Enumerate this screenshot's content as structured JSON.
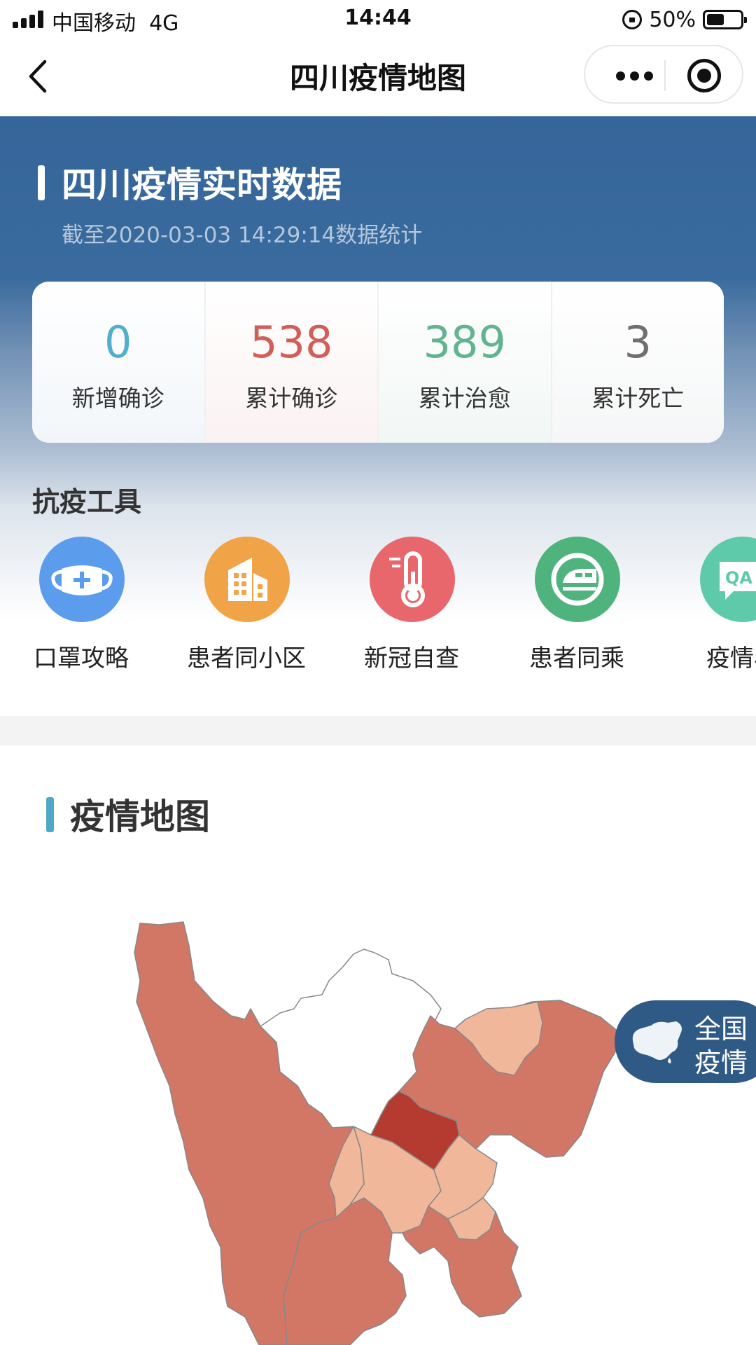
{
  "status_bar": {
    "carrier": "中国移动",
    "network": "4G",
    "time": "14:44",
    "battery_percent": "50%",
    "battery_level": 0.5
  },
  "nav": {
    "title": "四川疫情地图",
    "back_icon": "chevron-left-icon",
    "more_icon": "more-dots-icon",
    "close_icon": "target-close-icon"
  },
  "hero": {
    "title": "四川疫情实时数据",
    "subtitle": "截至2020-03-03 14:29:14数据统计"
  },
  "stats": [
    {
      "value": "0",
      "label": "新增确诊",
      "color": "#52aecb"
    },
    {
      "value": "538",
      "label": "累计确诊",
      "color": "#cf5f58"
    },
    {
      "value": "389",
      "label": "累计治愈",
      "color": "#62b491"
    },
    {
      "value": "3",
      "label": "累计死亡",
      "color": "#6f6f6f"
    }
  ],
  "tools": {
    "heading": "抗疫工具",
    "items": [
      {
        "label": "口罩攻略",
        "icon": "mask-icon",
        "color": "#5b9cec"
      },
      {
        "label": "患者同小区",
        "icon": "building-icon",
        "color": "#f0a447"
      },
      {
        "label": "新冠自查",
        "icon": "thermometer-icon",
        "color": "#e8676d"
      },
      {
        "label": "患者同乘",
        "icon": "train-icon",
        "color": "#4fb37e"
      },
      {
        "label": "疫情小",
        "icon": "qa-icon",
        "color": "#5fcaa9",
        "badge": "QA"
      }
    ]
  },
  "map": {
    "title": "疫情地图",
    "colors": {
      "high": "#b53a2f",
      "medium": "#d27665",
      "low": "#f1b79a",
      "none": "#ffffff",
      "border": "#888888"
    }
  },
  "nationwide_button": {
    "line1": "全国",
    "line2": "疫情",
    "icon": "china-map-icon"
  }
}
